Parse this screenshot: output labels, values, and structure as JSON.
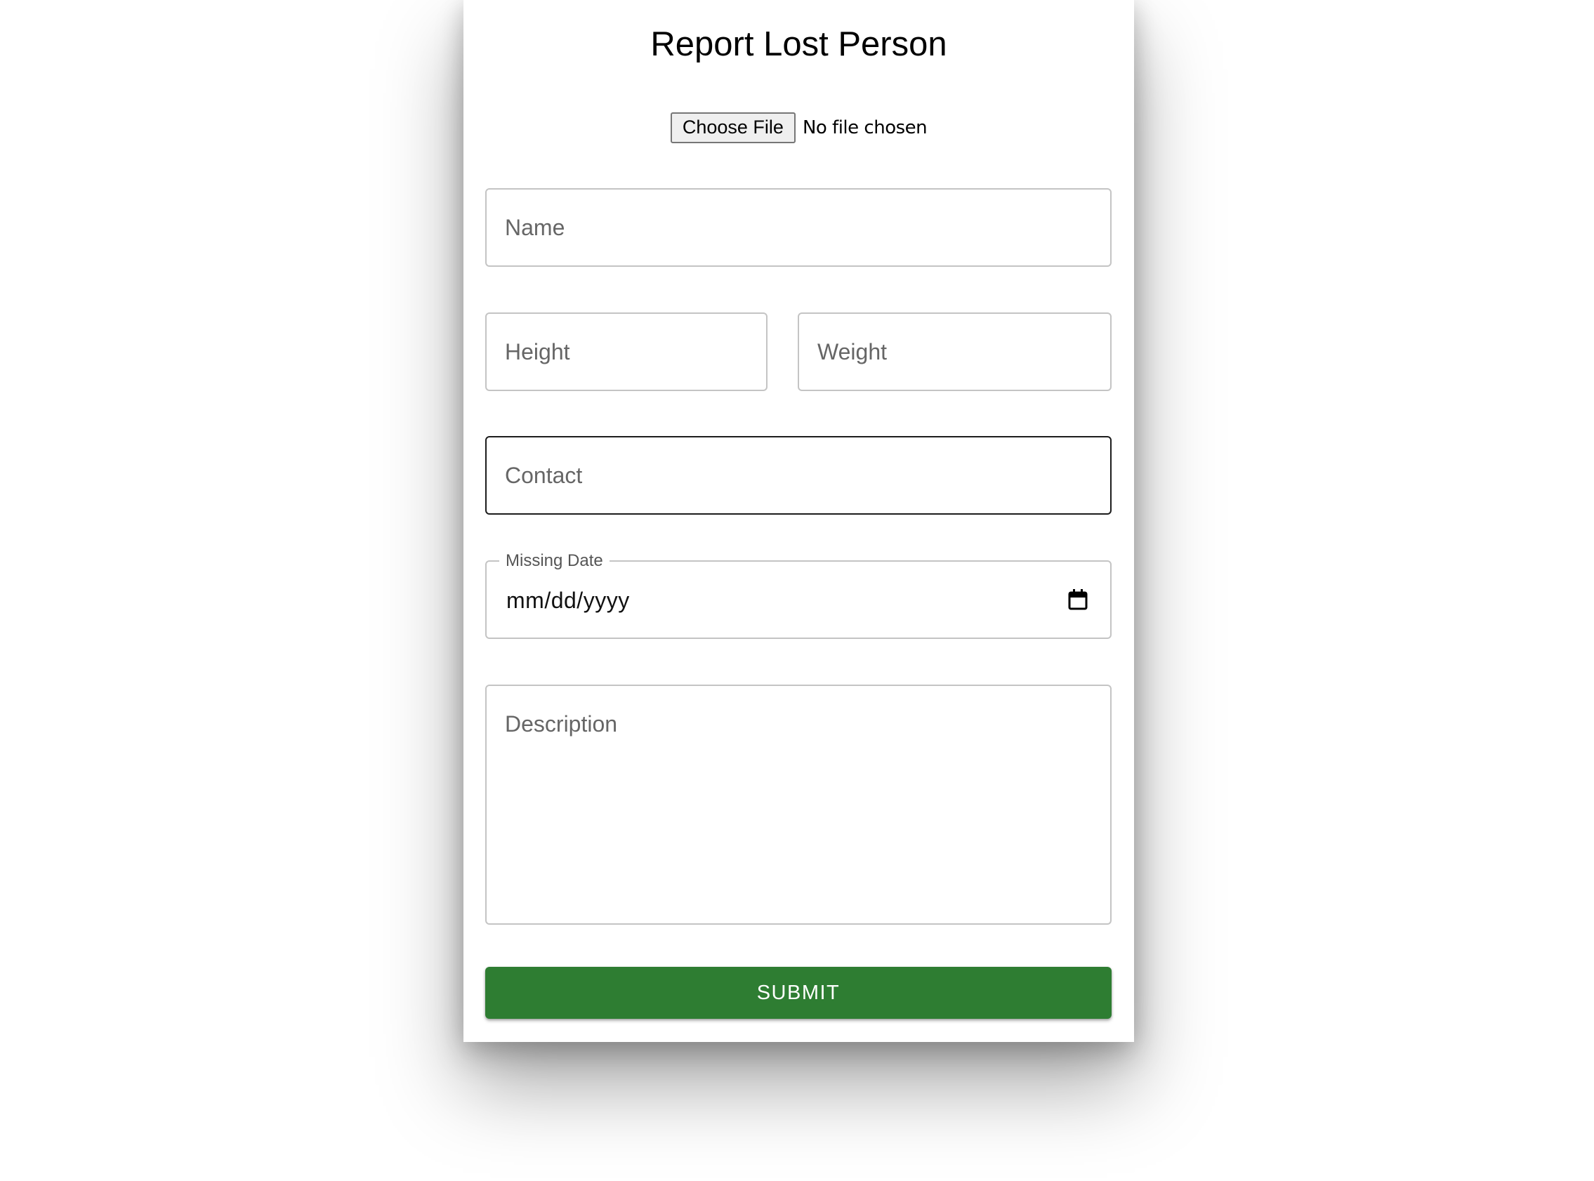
{
  "form": {
    "title": "Report Lost Person",
    "file_button_label": "Choose File",
    "file_status": "No file chosen",
    "name_placeholder": "Name",
    "height_placeholder": "Height",
    "weight_placeholder": "Weight",
    "contact_placeholder": "Contact",
    "missing_date_label": "Missing Date",
    "missing_date_value": "mm/dd/yyyy",
    "description_placeholder": "Description",
    "submit_label": "SUBMIT"
  },
  "colors": {
    "submit_background": "#2e7d32",
    "focused_border": "#1c1c1c",
    "field_border": "#c4c4c4"
  },
  "icons": {
    "date_picker": "calendar-icon"
  }
}
